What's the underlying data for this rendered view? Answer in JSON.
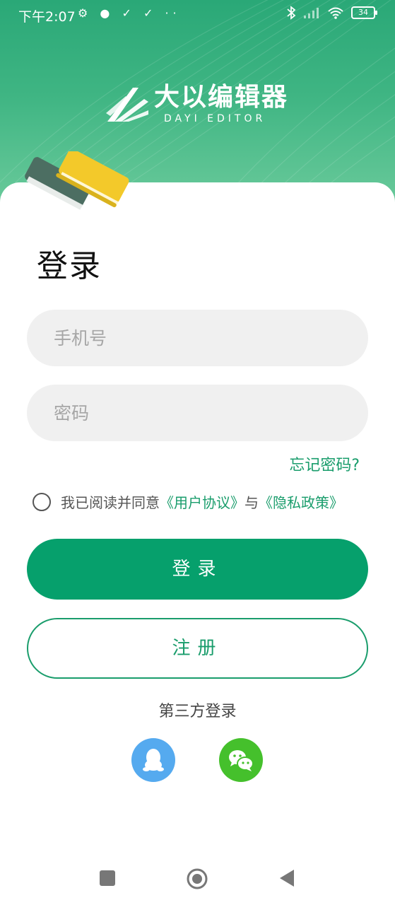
{
  "status_bar": {
    "time": "下午2:07",
    "left_icons": "⚙ ● ✓ ✓ ··",
    "battery": "34"
  },
  "brand": {
    "name": "大以编辑器",
    "subtitle": "DAYI EDITOR"
  },
  "login": {
    "title": "登录",
    "phone_placeholder": "手机号",
    "password_placeholder": "密码",
    "forgot_label": "忘记密码?",
    "agree_prefix": "我已阅读并同意",
    "user_agreement": "《用户协议》",
    "agree_and": "与",
    "privacy_policy": "《隐私政策》",
    "login_button": "登录",
    "register_button": "注册",
    "third_party_label": "第三方登录"
  },
  "social": [
    {
      "name": "qq-icon",
      "color": "#55aaef"
    },
    {
      "name": "wechat-icon",
      "color": "#45c02c"
    }
  ],
  "colors": {
    "accent": "#06a06c",
    "link": "#1a9d6c",
    "header_top": "#2aa877",
    "header_bottom": "#6ccb9c"
  }
}
